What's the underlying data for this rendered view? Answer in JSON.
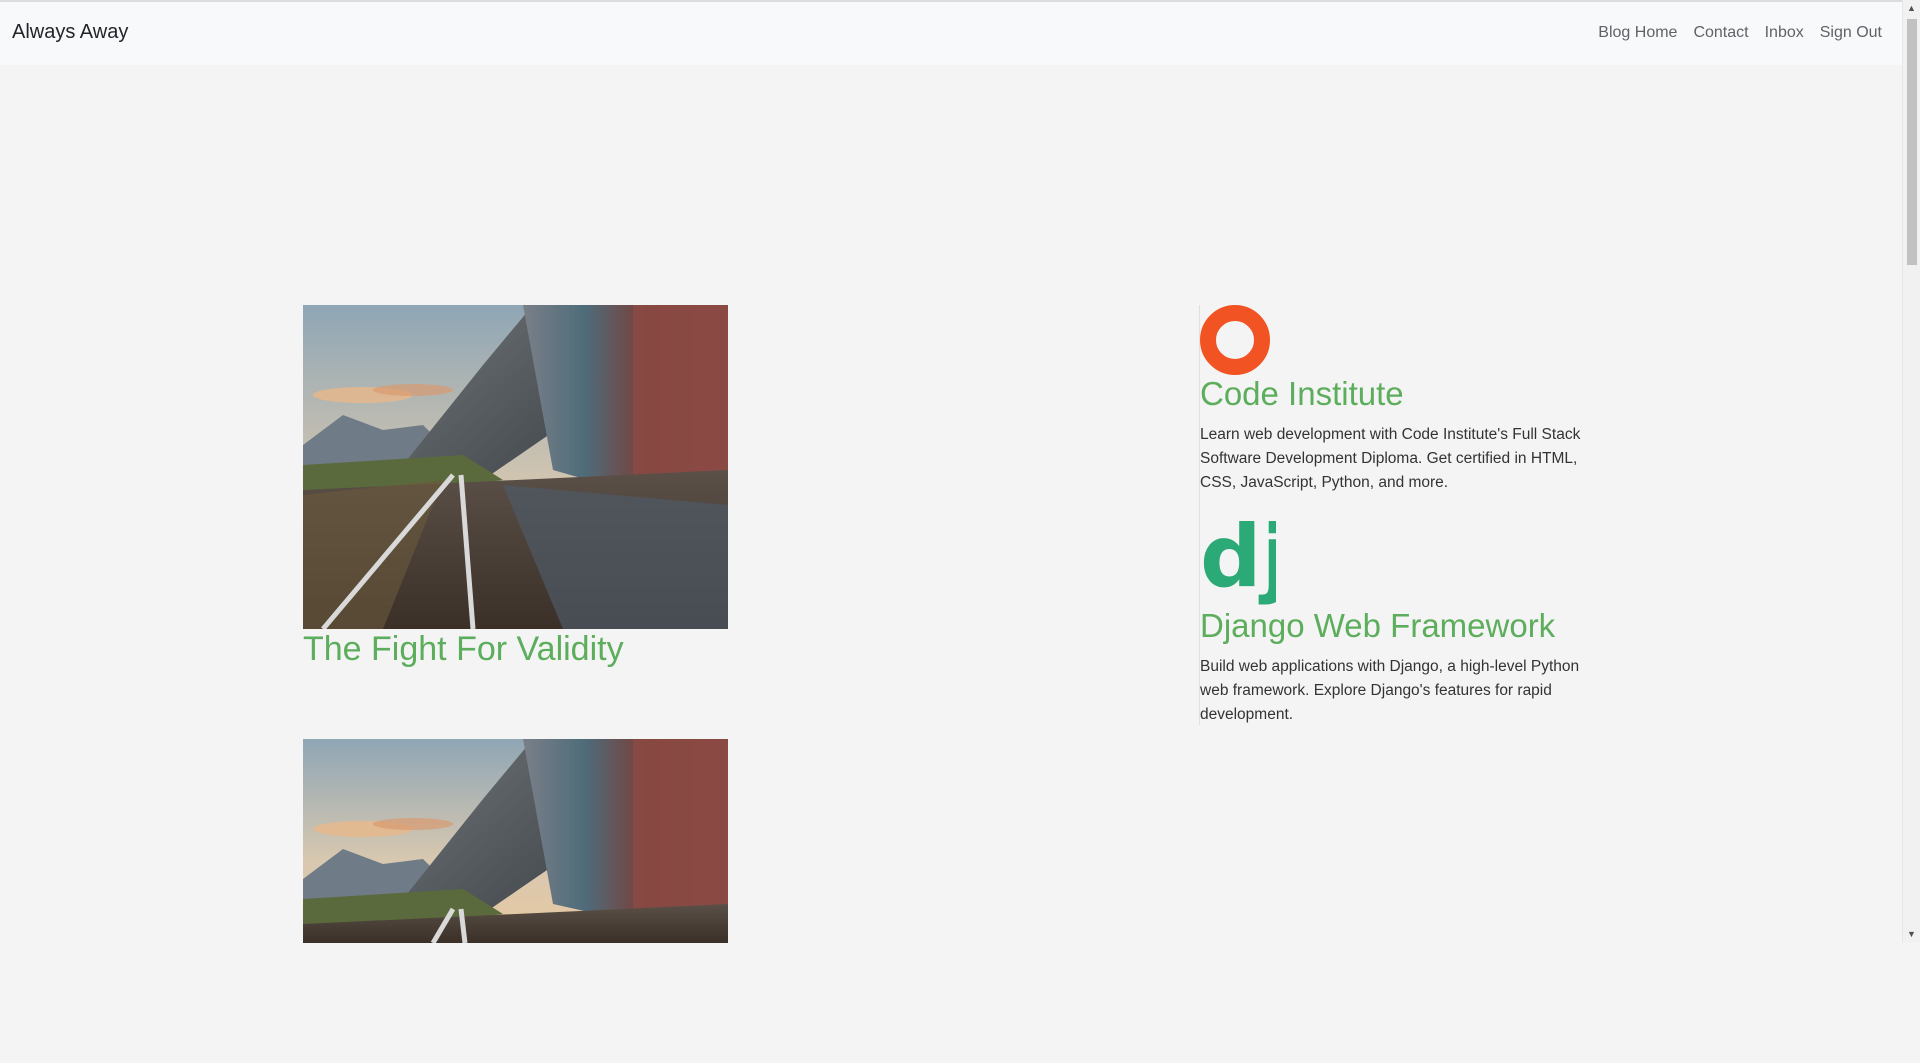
{
  "navbar": {
    "brand": "Always Away",
    "links": [
      "Blog Home",
      "Contact",
      "Inbox",
      "Sign Out"
    ]
  },
  "posts": [
    {
      "title": "The Fight For Validity",
      "image_icon": "mountain-railway-image"
    },
    {
      "title": "",
      "image_icon": "mountain-railway-image"
    }
  ],
  "sidebar": {
    "items": [
      {
        "logo_icon": "code-institute-logo",
        "logo_color": "#f25322",
        "title": "Code Institute",
        "text": "Learn web development with Code Institute's Full Stack Software Development Diploma. Get certified in HTML, CSS, JavaScript, Python, and more."
      },
      {
        "logo_icon": "django-logo",
        "logo_color": "#2ba977",
        "logo_text": "dj",
        "title": "Django Web Framework",
        "text": "Build web applications with Django, a high-level Python web framework. Explore Django's features for rapid development."
      }
    ]
  },
  "colors": {
    "accent_green": "#5cad5c",
    "page_background": "#f4f4f4",
    "navbar_background": "#f8f9fa"
  }
}
